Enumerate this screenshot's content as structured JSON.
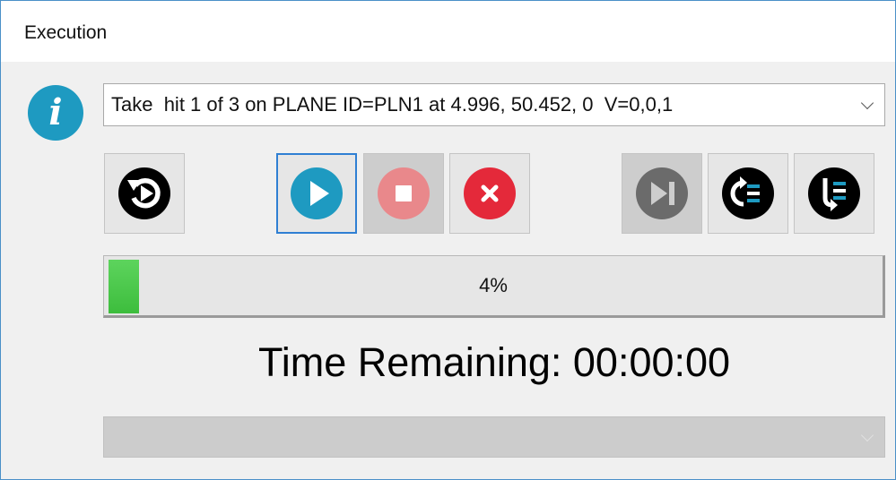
{
  "window": {
    "title": "Execution"
  },
  "info_icon": {
    "glyph": "i",
    "color": "#1e9ac1"
  },
  "step_select": {
    "value": "Take  hit 1 of 3 on PLANE ID=PLN1 at 4.996, 50.452, 0  V=0,0,1"
  },
  "toolbar": {
    "buttons": [
      {
        "name": "restart",
        "icon": "restart-icon",
        "enabled": true
      },
      {
        "name": "play",
        "icon": "play-icon",
        "enabled": true,
        "active": true,
        "color": "#1e9ac1"
      },
      {
        "name": "stop",
        "icon": "stop-icon",
        "enabled": false,
        "color": "#e9888b"
      },
      {
        "name": "cancel",
        "icon": "cancel-icon",
        "enabled": true,
        "color": "#e4293a"
      },
      {
        "name": "skip",
        "icon": "skip-icon",
        "enabled": false,
        "color": "#6b6b6b"
      },
      {
        "name": "loop-list",
        "icon": "loop-list-icon",
        "enabled": true
      },
      {
        "name": "step-list",
        "icon": "step-list-icon",
        "enabled": true
      }
    ]
  },
  "progress": {
    "percent": 4,
    "label": "4%",
    "color": "#4ccb4c"
  },
  "time_remaining": {
    "text": "Time Remaining: 00:00:00"
  },
  "bottom_select": {
    "value": "",
    "enabled": false
  }
}
